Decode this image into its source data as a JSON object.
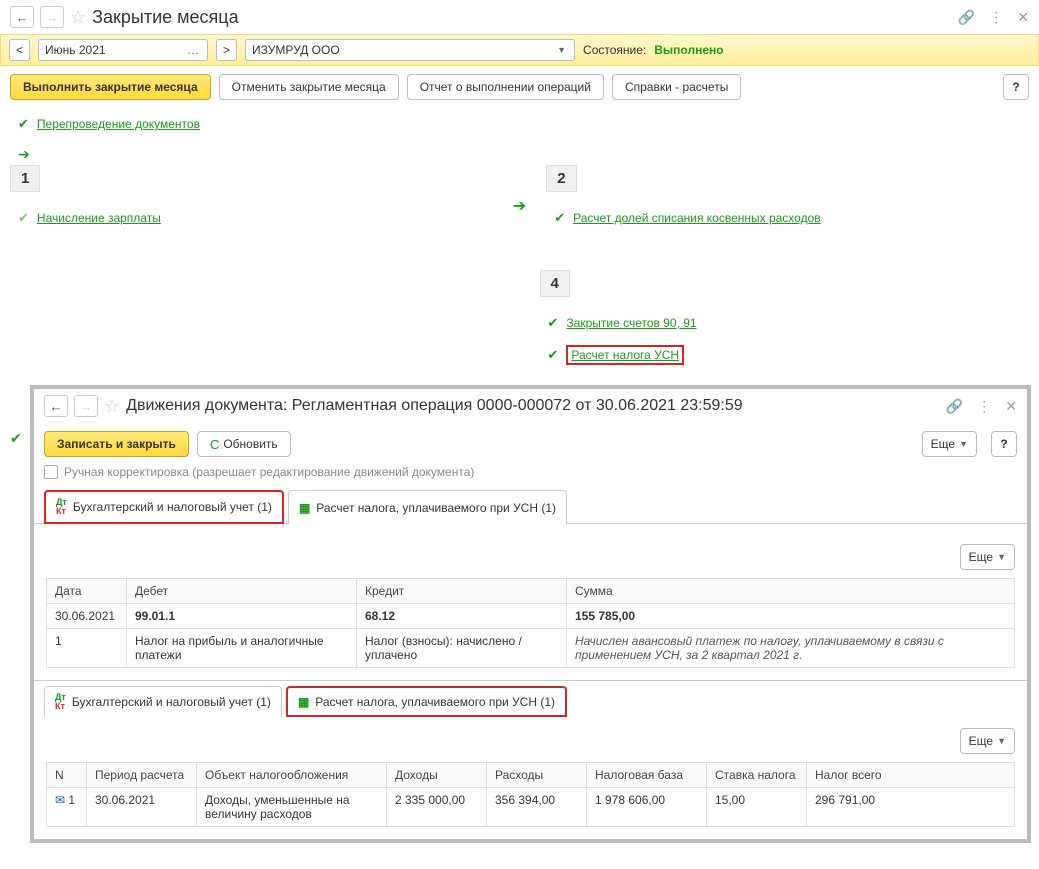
{
  "main": {
    "title": "Закрытие месяца",
    "period": "Июнь 2021",
    "org": "ИЗУМРУД ООО",
    "state_label": "Состояние:",
    "state_value": "Выполнено",
    "toolbar": {
      "run": "Выполнить закрытие месяца",
      "cancel": "Отменить закрытие месяца",
      "report": "Отчет о выполнении операций",
      "refs": "Справки - расчеты"
    },
    "reposting": "Перепроведение документов",
    "stage1": "1",
    "stage2": "2",
    "stage4": "4",
    "op_salary": "Начисление зарплаты",
    "op_indirect": "Расчет долей списания косвенных расходов",
    "op_close_90_91": "Закрытие счетов 90, 91",
    "op_usn_tax": "Расчет налога УСН"
  },
  "sub": {
    "title": "Движения документа: Регламентная операция 0000-000072 от 30.06.2021 23:59:59",
    "write_close": "Записать и закрыть",
    "refresh": "Обновить",
    "more": "Еще",
    "manual": "Ручная корректировка (разрешает редактирование движений документа)",
    "tab1": "Бухгалтерский и налоговый учет (1)",
    "tab2": "Расчет налога, уплачиваемого при УСН (1)",
    "headers1": {
      "date": "Дата",
      "debit": "Дебет",
      "credit": "Кредит",
      "sum": "Сумма"
    },
    "row1": {
      "date": "30.06.2021",
      "n": "1",
      "debit_acc": "99.01.1",
      "debit_desc": "Налог на прибыль и аналогичные платежи",
      "credit_acc": "68.12",
      "credit_desc": "Налог (взносы): начислено / уплачено",
      "sum": "155 785,00",
      "sum_desc": "Начислен авансовый платеж по налогу, уплачиваемому в связи с применением УСН, за 2 квартал 2021 г."
    },
    "headers2": {
      "n": "N",
      "period": "Период расчета",
      "obj": "Объект налогообложения",
      "income": "Доходы",
      "expense": "Расходы",
      "base": "Налоговая база",
      "rate": "Ставка налога",
      "tax": "Налог всего"
    },
    "row2": {
      "n": "1",
      "period": "30.06.2021",
      "obj": "Доходы, уменьшенные на величину расходов",
      "income": "2 335 000,00",
      "expense": "356 394,00",
      "base": "1 978 606,00",
      "rate": "15,00",
      "tax": "296 791,00"
    }
  }
}
